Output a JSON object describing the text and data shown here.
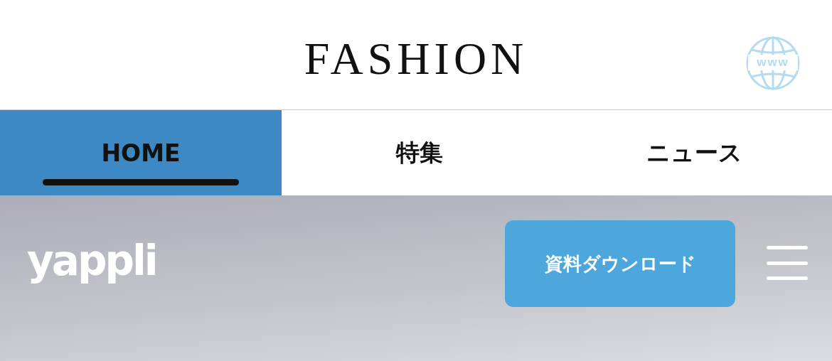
{
  "header": {
    "title": "FASHION",
    "globe_label": "www"
  },
  "tabs": [
    {
      "label": "HOME",
      "selected": true
    },
    {
      "label": "特集",
      "selected": false
    },
    {
      "label": "ニュース",
      "selected": false
    }
  ],
  "banner": {
    "logo": "yappli",
    "button": "資料ダウンロード"
  }
}
